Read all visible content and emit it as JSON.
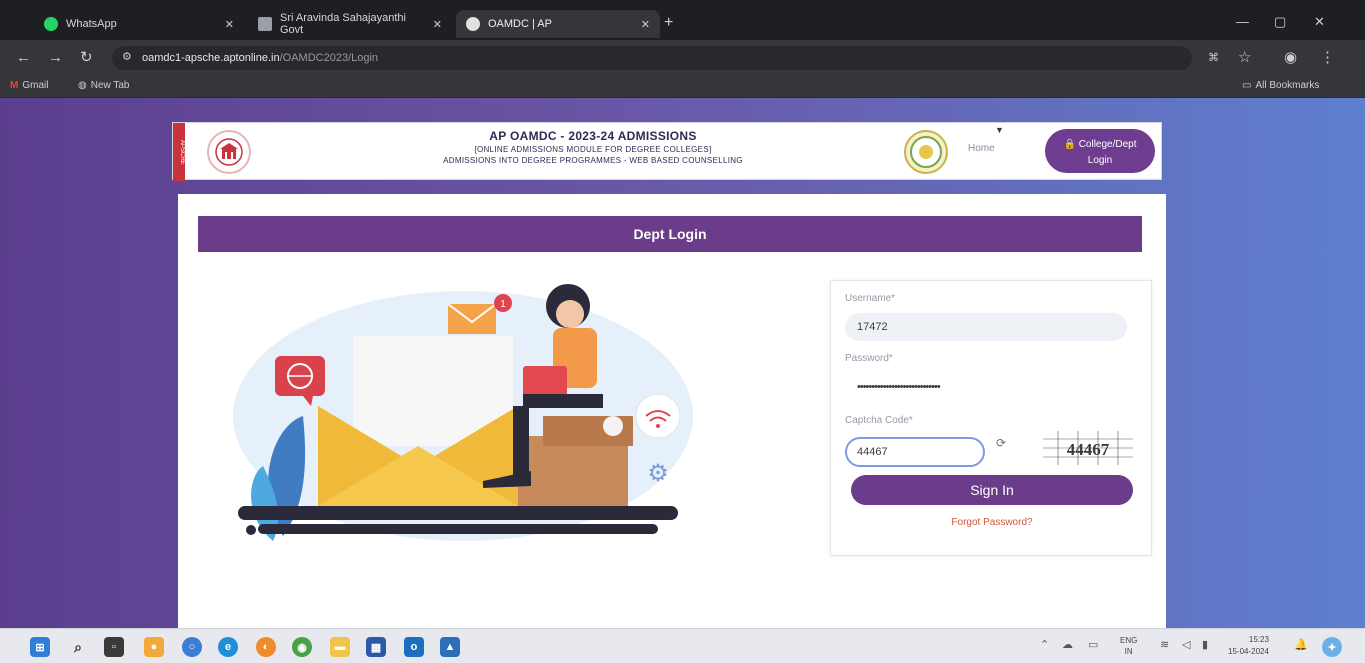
{
  "browser": {
    "tabs": [
      {
        "title": "WhatsApp",
        "fav_color": "#25d366",
        "active": false
      },
      {
        "title": "Sri Aravinda Sahajayanthi Govt",
        "fav_color": "#9aa0a6",
        "active": false
      },
      {
        "title": "OAMDC | AP",
        "fav_color": "#c7c7c7",
        "active": true
      }
    ],
    "url_host": "oamdc1-apsche.aptonline.in",
    "url_path": "/OAMDC2023/Login",
    "bookmarks": [
      {
        "label": "Gmail",
        "icon": "gmail-icon"
      },
      {
        "label": "New Tab",
        "icon": "globe-icon"
      }
    ],
    "all_bookmarks": "All Bookmarks"
  },
  "header": {
    "ribbon": "APSCHE",
    "title": "AP OAMDC - 2023-24 ADMISSIONS",
    "subtitle1": "[ONLINE ADMISSIONS MODULE FOR DEGREE COLLEGES]",
    "subtitle2": "ADMISSIONS INTO DEGREE PROGRAMMES - WEB BASED COUNSELLING",
    "home": "Home",
    "login_btn_line1": "College/Dept",
    "login_btn_line2": "Login"
  },
  "login": {
    "heading": "Dept Login",
    "username_label": "Username*",
    "username_value": "17472",
    "password_label": "Password*",
    "password_value": "•••••••••••••••••••••••••••••",
    "captcha_label": "Captcha Code*",
    "captcha_value": "44467",
    "captcha_image_text": "44467",
    "signin": "Sign In",
    "forgot": "Forgot Password?"
  },
  "illustration": {
    "notification_count": "1"
  },
  "taskbar": {
    "lang_line1": "ENG",
    "lang_line2": "IN",
    "time": "15:23",
    "date": "15-04-2024"
  },
  "colors": {
    "accent": "#6a3c89",
    "link": "#d4553a",
    "bg_left": "#5b3f8e",
    "bg_right": "#5e7fcf"
  }
}
